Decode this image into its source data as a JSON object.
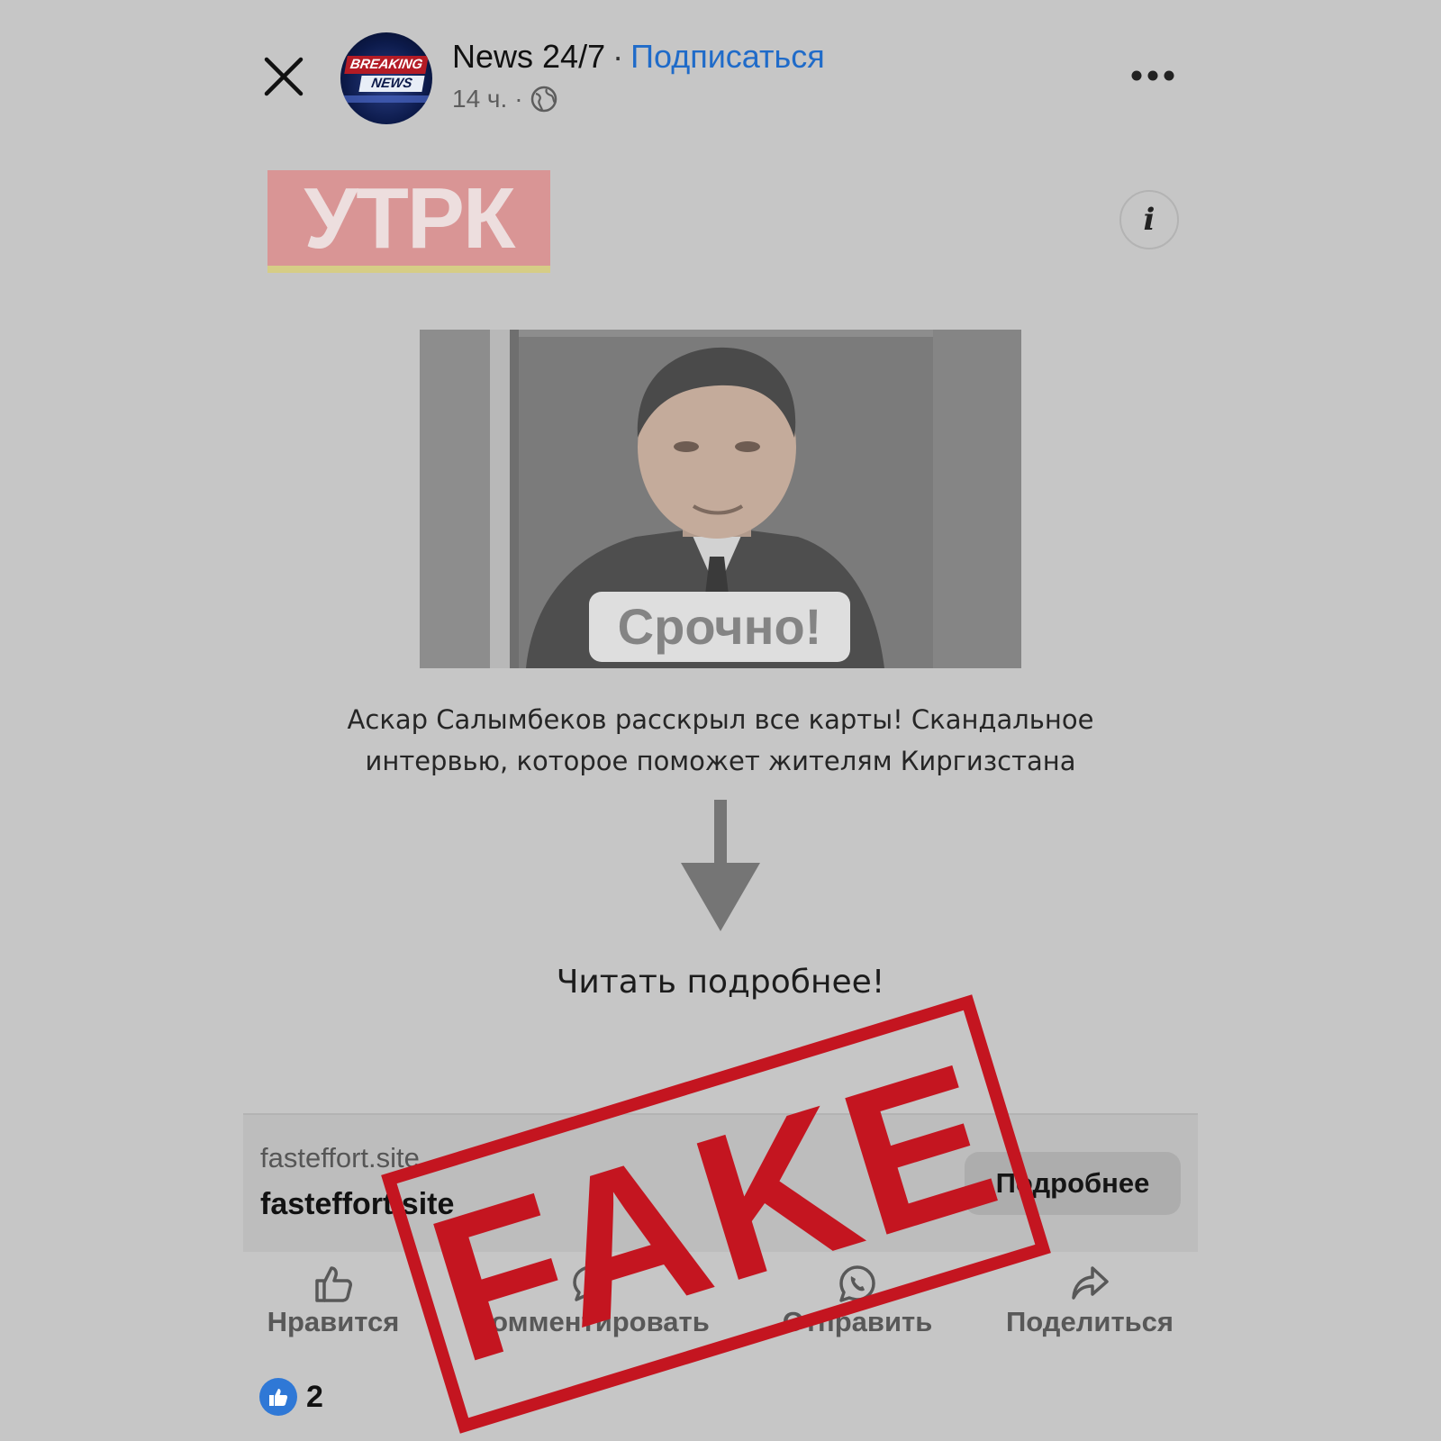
{
  "header": {
    "page_name": "News 24/7",
    "separator": "·",
    "subscribe_label": "Подписаться",
    "time": "14 ч.",
    "dot": "·",
    "avatar_text_top": "BREAKING",
    "avatar_text_bottom": "NEWS",
    "icons": {
      "close": "close-icon",
      "more": "more-dots-icon",
      "audience": "globe-icon"
    }
  },
  "post": {
    "logo_text": "УТРК",
    "info_icon": "i",
    "photo_badge": "Срочно!",
    "headline": "Аскар Салымбеков расскрыл все карты! Скандальное интервью, которое поможет жителям Киргизстана",
    "read_more": "Читать подробнее!"
  },
  "link_card": {
    "domain": "fasteffort.site",
    "title": "fasteffort.site",
    "button_label": "Подробнее"
  },
  "actions": [
    {
      "label": "Нравится",
      "icon": "thumbs-up-icon"
    },
    {
      "label": "Комментировать",
      "icon": "comment-icon"
    },
    {
      "label": "Отправить",
      "icon": "whatsapp-icon"
    },
    {
      "label": "Поделиться",
      "icon": "share-icon"
    }
  ],
  "reactions": {
    "count": "2",
    "icon": "like-reaction-icon"
  },
  "stamp": {
    "text": "FAKE",
    "color": "#c41520"
  },
  "colors": {
    "accent": "#1f6bc9",
    "background": "#c6c6c6"
  }
}
